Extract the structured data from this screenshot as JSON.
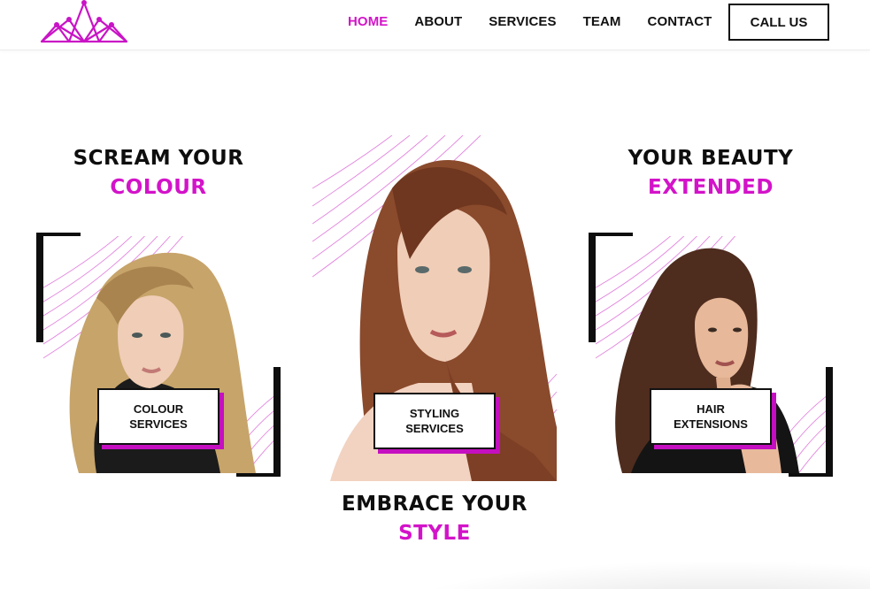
{
  "header": {
    "logo_icon": "crown-icon",
    "nav": [
      {
        "label": "HOME",
        "active": true
      },
      {
        "label": "ABOUT",
        "active": false
      },
      {
        "label": "SERVICES",
        "active": false
      },
      {
        "label": "TEAM",
        "active": false
      },
      {
        "label": "CONTACT",
        "active": false
      }
    ],
    "cta_label": "CALL US"
  },
  "colors": {
    "accent": "#d313c9",
    "text": "#111111",
    "background": "#ffffff"
  },
  "sections": {
    "left": {
      "line1": "SCREAM YOUR",
      "line2": "COLOUR",
      "button_line1": "COLOUR",
      "button_line2": "SERVICES"
    },
    "center": {
      "line1": "EMBRACE YOUR",
      "line2": "STYLE",
      "button_line1": "STYLING",
      "button_line2": "SERVICES"
    },
    "right": {
      "line1": "YOUR BEAUTY",
      "line2": "EXTENDED",
      "button_line1": "HAIR",
      "button_line2": "EXTENSIONS"
    }
  }
}
